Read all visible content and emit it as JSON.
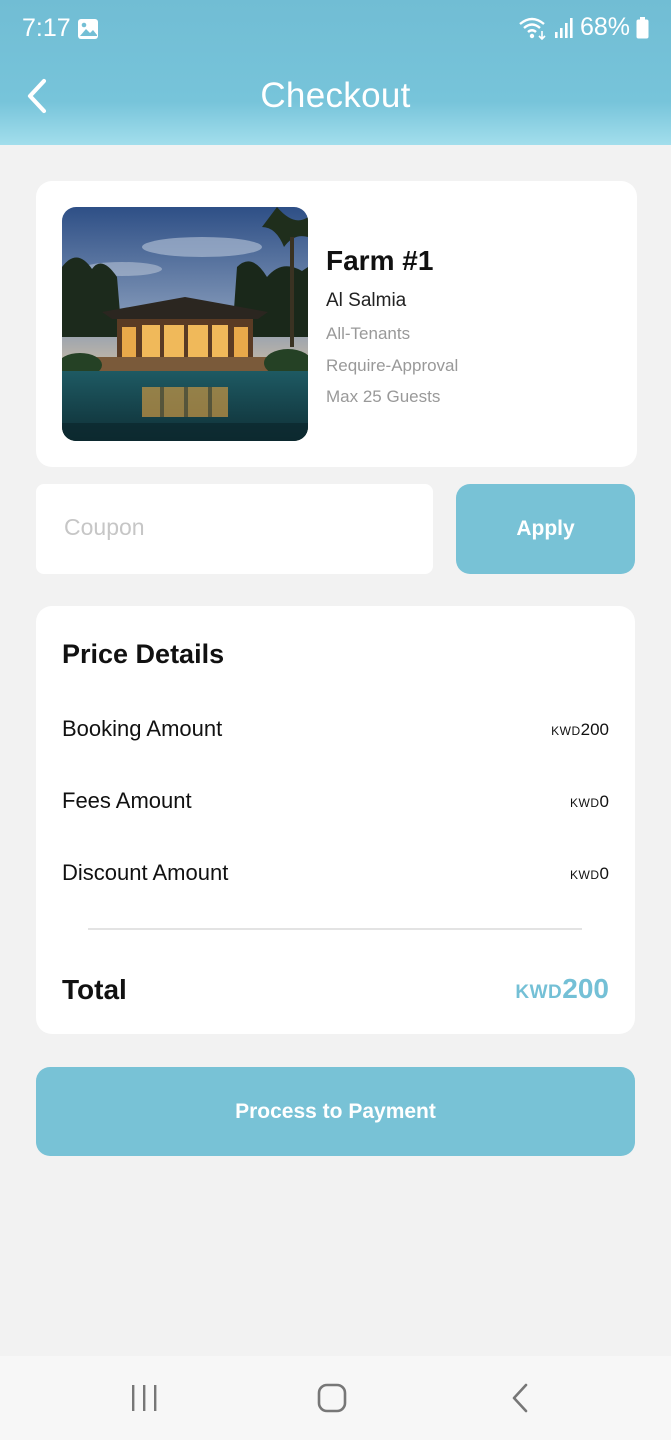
{
  "status_bar": {
    "time": "7:17",
    "battery": "68%",
    "icons": [
      "image-icon",
      "wifi-icon",
      "signal-icon",
      "battery-icon"
    ]
  },
  "header": {
    "title": "Checkout",
    "back_icon": "chevron-left-icon"
  },
  "property": {
    "name": "Farm #1",
    "location": "Al Salmia",
    "tenants": "All-Tenants",
    "approval": "Require-Approval",
    "max_guests": "Max 25 Guests"
  },
  "coupon": {
    "placeholder": "Coupon",
    "value": "",
    "apply_label": "Apply"
  },
  "price_details": {
    "title": "Price Details",
    "currency": "KWD",
    "rows": [
      {
        "label": "Booking Amount",
        "amount": "200"
      },
      {
        "label": "Fees Amount",
        "amount": "0"
      },
      {
        "label": "Discount Amount",
        "amount": "0"
      }
    ],
    "total_label": "Total",
    "total_amount": "200"
  },
  "payment": {
    "button_label": "Process to Payment"
  },
  "colors": {
    "accent": "#78c2d6",
    "header_top": "#71bdd4",
    "background": "#f2f2f2"
  },
  "nav_bar": {
    "icons": [
      "recent-apps-icon",
      "home-icon",
      "back-icon"
    ]
  }
}
